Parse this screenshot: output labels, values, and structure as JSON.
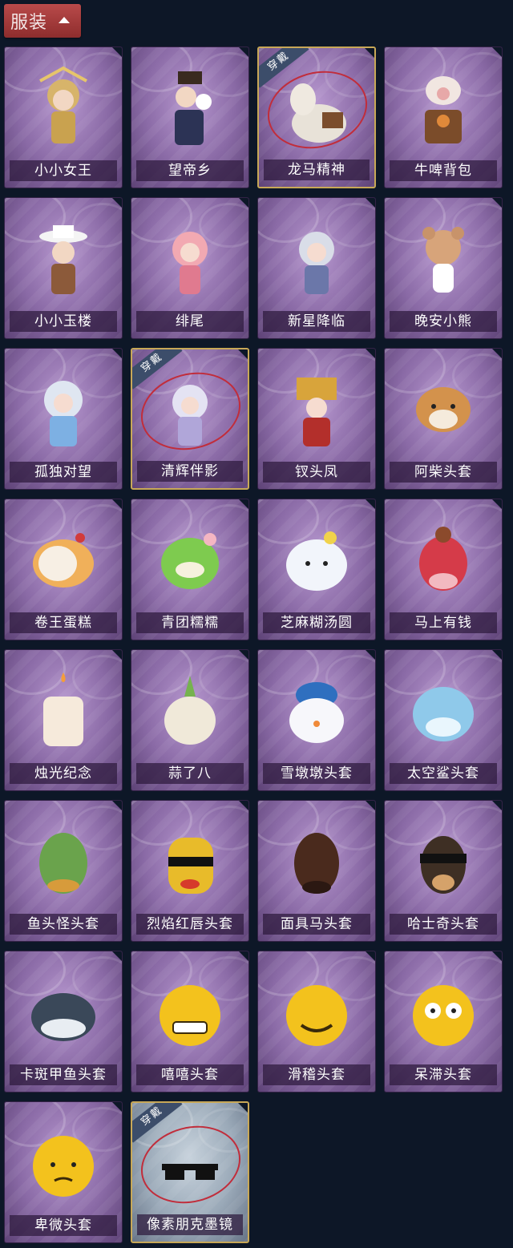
{
  "header": {
    "title": "服装",
    "collapse_icon": "chevron-up-icon"
  },
  "equipped_badge": "穿戴",
  "colors": {
    "background": "#0d1727",
    "header": "#a93d3d",
    "card": "#8a6aa6",
    "equipped_border": "#c8a857",
    "equipped_ring": "#c12d3b"
  },
  "items": [
    {
      "label": "小小女王",
      "icon": "queen-figure-icon",
      "equipped": false
    },
    {
      "label": "望帝乡",
      "icon": "emperor-figure-icon",
      "equipped": false
    },
    {
      "label": "龙马精神",
      "icon": "plush-horse-icon",
      "equipped": true
    },
    {
      "label": "牛啤背包",
      "icon": "cow-barrel-icon",
      "equipped": false
    },
    {
      "label": "小小玉楼",
      "icon": "hat-figure-icon",
      "equipped": false
    },
    {
      "label": "绯尾",
      "icon": "fox-girl-figure-icon",
      "equipped": false
    },
    {
      "label": "新星降临",
      "icon": "silver-hair-figure-icon",
      "equipped": false
    },
    {
      "label": "晚安小熊",
      "icon": "teddy-bear-icon",
      "equipped": false
    },
    {
      "label": "孤独对望",
      "icon": "blue-figure-icon",
      "equipped": false
    },
    {
      "label": "清辉伴影",
      "icon": "white-dragon-figure-icon",
      "equipped": true
    },
    {
      "label": "钗头凤",
      "icon": "phoenix-crown-figure-icon",
      "equipped": false
    },
    {
      "label": "阿柴头套",
      "icon": "shiba-head-icon",
      "equipped": false
    },
    {
      "label": "卷王蛋糕",
      "icon": "roll-cake-icon",
      "equipped": false
    },
    {
      "label": "青团糯糯",
      "icon": "green-dumpling-icon",
      "equipped": false
    },
    {
      "label": "芝麻糊汤圆",
      "icon": "rice-ball-icon",
      "equipped": false
    },
    {
      "label": "马上有钱",
      "icon": "red-horse-head-icon",
      "equipped": false
    },
    {
      "label": "烛光纪念",
      "icon": "candle-icon",
      "equipped": false
    },
    {
      "label": "蒜了八",
      "icon": "garlic-icon",
      "equipped": false
    },
    {
      "label": "雪墩墩头套",
      "icon": "snowman-icon",
      "equipped": false
    },
    {
      "label": "太空鲨头套",
      "icon": "shark-head-icon",
      "equipped": false
    },
    {
      "label": "鱼头怪头套",
      "icon": "fish-head-icon",
      "equipped": false
    },
    {
      "label": "烈焰红唇头套",
      "icon": "yellow-mask-icon",
      "equipped": false
    },
    {
      "label": "面具马头套",
      "icon": "horse-mask-icon",
      "equipped": false
    },
    {
      "label": "哈士奇头套",
      "icon": "dog-sunglasses-icon",
      "equipped": false
    },
    {
      "label": "卡斑甲鱼头套",
      "icon": "turtle-head-icon",
      "equipped": false
    },
    {
      "label": "嘻嘻头套",
      "icon": "grin-emoji-icon",
      "equipped": false
    },
    {
      "label": "滑稽头套",
      "icon": "smirk-emoji-icon",
      "equipped": false
    },
    {
      "label": "呆滞头套",
      "icon": "stare-emoji-icon",
      "equipped": false
    },
    {
      "label": "卑微头套",
      "icon": "humble-emoji-icon",
      "equipped": false
    },
    {
      "label": "像素朋克墨镜",
      "icon": "pixel-sunglasses-icon",
      "equipped": true
    }
  ]
}
